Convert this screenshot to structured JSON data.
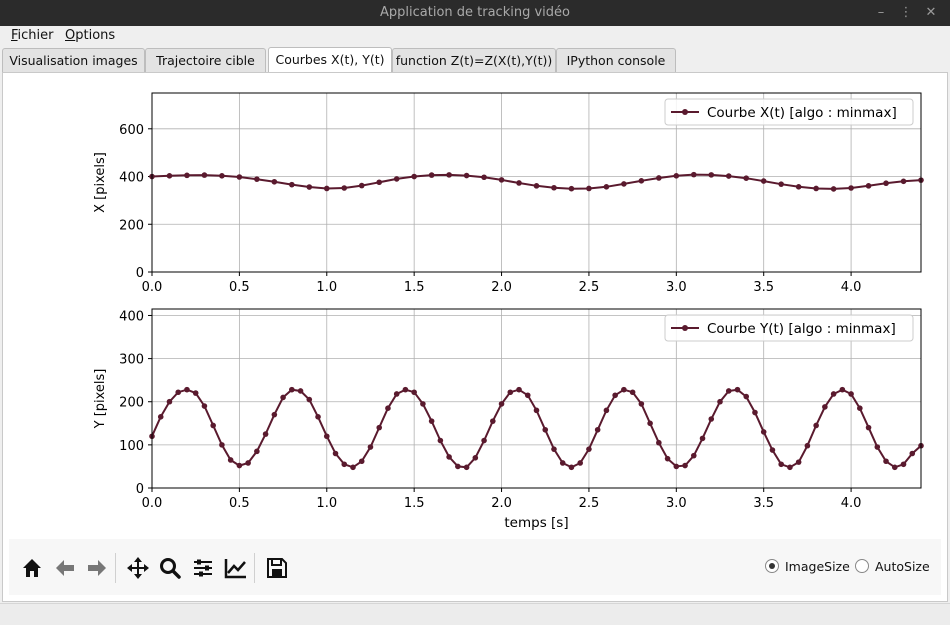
{
  "window": {
    "title": "Application de tracking vidéo"
  },
  "menu": [
    {
      "mnemonic": "F",
      "rest": "ichier"
    },
    {
      "mnemonic": "O",
      "rest": "ptions"
    }
  ],
  "tabs": [
    {
      "label": "Visualisation images"
    },
    {
      "label": "Trajectoire cible"
    },
    {
      "label": "Courbes X(t), Y(t)",
      "active": true
    },
    {
      "label": "function Z(t)=Z(X(t),Y(t))"
    },
    {
      "label": "IPython console"
    }
  ],
  "toolbar": {
    "buttons": [
      "home-icon",
      "back-icon",
      "forward-icon",
      "pan-icon",
      "zoom-icon",
      "configure-subplots-icon",
      "edit-axis-icon",
      "save-icon"
    ],
    "radio_image_size": "ImageSize",
    "radio_auto_size": "AutoSize",
    "selected": "ImageSize"
  },
  "chart_data": [
    {
      "type": "line",
      "ylabel": "X [pixels]",
      "xlabel": "",
      "xlim": [
        0.0,
        4.4
      ],
      "ylim": [
        0,
        750
      ],
      "xticks": [
        "0.0",
        "0.5",
        "1.0",
        "1.5",
        "2.0",
        "2.5",
        "3.0",
        "3.5",
        "4.0"
      ],
      "yticks": [
        "0",
        "200",
        "400",
        "600"
      ],
      "grid": true,
      "legend_position": "top-right",
      "color": "#5a1a2e",
      "series": [
        {
          "name": "Courbe X(t) [algo : minmax]",
          "x": [
            0.0,
            0.1,
            0.2,
            0.3,
            0.4,
            0.5,
            0.6,
            0.7,
            0.8,
            0.9,
            1.0,
            1.1,
            1.2,
            1.3,
            1.4,
            1.5,
            1.6,
            1.7,
            1.8,
            1.9,
            2.0,
            2.1,
            2.2,
            2.3,
            2.4,
            2.5,
            2.6,
            2.7,
            2.8,
            2.9,
            3.0,
            3.1,
            3.2,
            3.3,
            3.4,
            3.5,
            3.6,
            3.7,
            3.8,
            3.9,
            4.0,
            4.1,
            4.2,
            4.3,
            4.4
          ],
          "y": [
            400,
            403,
            405,
            406,
            403,
            398,
            389,
            378,
            366,
            356,
            350,
            352,
            362,
            376,
            390,
            400,
            406,
            407,
            404,
            397,
            386,
            373,
            361,
            353,
            349,
            350,
            357,
            369,
            382,
            394,
            403,
            408,
            407,
            402,
            393,
            381,
            368,
            357,
            350,
            348,
            352,
            361,
            372,
            380,
            385
          ]
        }
      ]
    },
    {
      "type": "line",
      "ylabel": "Y [pixels]",
      "xlabel": "temps [s]",
      "xlim": [
        0.0,
        4.4
      ],
      "ylim": [
        0,
        415
      ],
      "xticks": [
        "0.0",
        "0.5",
        "1.0",
        "1.5",
        "2.0",
        "2.5",
        "3.0",
        "3.5",
        "4.0"
      ],
      "yticks": [
        "0",
        "100",
        "200",
        "300",
        "400"
      ],
      "grid": true,
      "legend_position": "top-right",
      "color": "#5a1a2e",
      "series": [
        {
          "name": "Courbe Y(t) [algo : minmax]",
          "x": [
            0.0,
            0.05,
            0.1,
            0.15,
            0.2,
            0.25,
            0.3,
            0.35,
            0.4,
            0.45,
            0.5,
            0.55,
            0.6,
            0.65,
            0.7,
            0.75,
            0.8,
            0.85,
            0.9,
            0.95,
            1.0,
            1.05,
            1.1,
            1.15,
            1.2,
            1.25,
            1.3,
            1.35,
            1.4,
            1.45,
            1.5,
            1.55,
            1.6,
            1.65,
            1.7,
            1.75,
            1.8,
            1.85,
            1.9,
            1.95,
            2.0,
            2.05,
            2.1,
            2.15,
            2.2,
            2.25,
            2.3,
            2.35,
            2.4,
            2.45,
            2.5,
            2.55,
            2.6,
            2.65,
            2.7,
            2.75,
            2.8,
            2.85,
            2.9,
            2.95,
            3.0,
            3.05,
            3.1,
            3.15,
            3.2,
            3.25,
            3.3,
            3.35,
            3.4,
            3.45,
            3.5,
            3.55,
            3.6,
            3.65,
            3.7,
            3.75,
            3.8,
            3.85,
            3.9,
            3.95,
            4.0,
            4.05,
            4.1,
            4.15,
            4.2,
            4.25,
            4.3,
            4.35,
            4.4
          ],
          "y": [
            120,
            165,
            200,
            222,
            228,
            220,
            190,
            145,
            100,
            65,
            52,
            58,
            85,
            125,
            170,
            210,
            228,
            225,
            205,
            165,
            120,
            80,
            55,
            48,
            62,
            95,
            140,
            185,
            218,
            228,
            222,
            195,
            155,
            110,
            72,
            50,
            48,
            70,
            110,
            155,
            195,
            222,
            228,
            215,
            180,
            135,
            90,
            58,
            48,
            58,
            90,
            135,
            180,
            215,
            228,
            222,
            195,
            150,
            105,
            68,
            50,
            52,
            75,
            115,
            160,
            200,
            225,
            228,
            212,
            175,
            130,
            88,
            55,
            48,
            60,
            98,
            145,
            188,
            218,
            228,
            218,
            185,
            140,
            95,
            62,
            48,
            55,
            80,
            98
          ]
        }
      ]
    }
  ]
}
